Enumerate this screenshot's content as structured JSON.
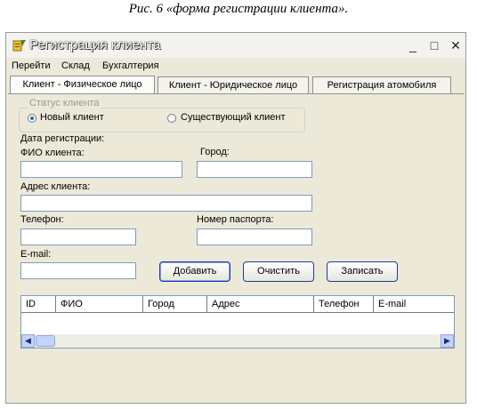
{
  "caption": "Рис. 6 «форма регистрации клиента».",
  "window": {
    "title": "Регистрация клиента",
    "controls": {
      "minimize": "_",
      "maximize": "□",
      "close": "✕"
    }
  },
  "menu": [
    "Перейти",
    "Склад",
    "Бухгалтерия"
  ],
  "tabs": [
    {
      "label": "Клиент - Физическое лицо",
      "active": true
    },
    {
      "label": "Клиент - Юридическое лицо",
      "active": false
    },
    {
      "label": "Регистрация атомобиля",
      "active": false
    }
  ],
  "client_status": {
    "group_label": "Статус клиента",
    "options": [
      {
        "label": "Новый клиент",
        "selected": true
      },
      {
        "label": "Существующий клиент",
        "selected": false
      }
    ]
  },
  "form": {
    "registration_date_label": "Дата регистрации:",
    "name_label": "ФИО клиента:",
    "name_value": "",
    "city_label": "Город:",
    "city_value": "",
    "address_label": "Адрес клиента:",
    "address_value": "",
    "phone_label": "Телефон:",
    "phone_value": "",
    "passport_label": "Номер паспорта:",
    "passport_value": "",
    "email_label": "E-mail:",
    "email_value": ""
  },
  "buttons": {
    "add": "Добавить",
    "clear": "Очистить",
    "save": "Записать"
  },
  "table": {
    "columns": [
      "ID",
      "ФИО",
      "Город",
      "Адрес",
      "Телефон",
      "E-mail"
    ],
    "rows": []
  },
  "scrollbar": {
    "left_icon": "arrow-left-icon",
    "right_icon": "arrow-right-icon"
  }
}
